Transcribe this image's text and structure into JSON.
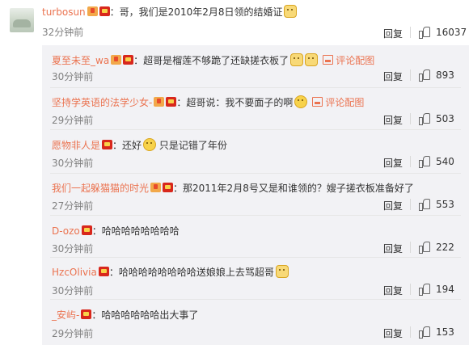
{
  "top_comment": {
    "username": "turbosun",
    "text": "：哥，我们是2010年2月8日领的结婚证",
    "time": "32分钟前",
    "reply_label": "回复",
    "likes": "16037"
  },
  "replies": [
    {
      "username": "夏至未至_wa",
      "text": "：超哥是榴莲不够跪了还缺搓衣板了",
      "extra": "评论配图",
      "time": "30分钟前",
      "reply_label": "回复",
      "likes": "893"
    },
    {
      "username": "坚持学英语的法学少女-",
      "text": "：超哥说：我不要面子的啊",
      "extra": "评论配图",
      "time": "29分钟前",
      "reply_label": "回复",
      "likes": "503"
    },
    {
      "username": "愿物非人是",
      "text_a": "：还好",
      "text_b": "只是记错了年份",
      "time": "30分钟前",
      "reply_label": "回复",
      "likes": "540"
    },
    {
      "username": "我们一起躲猫猫的时光",
      "text": "：那2011年2月8号又是和谁领的？嫂子搓衣板准备好了",
      "time": "27分钟前",
      "reply_label": "回复",
      "likes": "553"
    },
    {
      "username": "D-ozo",
      "text": "：哈哈哈哈哈哈哈哈",
      "time": "30分钟前",
      "reply_label": "回复",
      "likes": "222"
    },
    {
      "username": "HzcOlivia",
      "text": "：哈哈哈哈哈哈哈哈送娘娘上去骂超哥",
      "time": "30分钟前",
      "reply_label": "回复",
      "likes": "194"
    },
    {
      "username": "_安屿-",
      "text": "：哈哈哈哈哈哈出大事了",
      "time": "29分钟前",
      "reply_label": "回复",
      "likes": "153"
    }
  ],
  "colors": {
    "username": "#eb7350",
    "reply_bg": "#f2f2f5",
    "time": "#808080"
  }
}
